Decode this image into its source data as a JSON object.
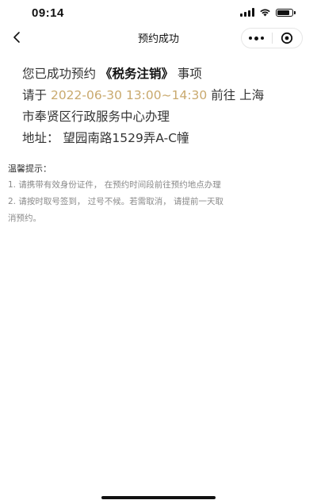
{
  "status_bar": {
    "time": "09:14"
  },
  "nav": {
    "back_icon": "chevron-left-icon",
    "title": "预约成功",
    "more_icon": "more-dots-icon",
    "close_icon": "target-circle-icon"
  },
  "message": {
    "line1_prefix": "您已成功预约",
    "line1_item": "《税务注销》",
    "line1_suffix": "事项",
    "line2_prefix": "请于",
    "line2_time": "2022-06-30 13:00~14:30",
    "line2_suffix": "前往 上海",
    "line3": "市奉贤区行政服务中心办理",
    "line4": "地址： 望园南路1529弄A-C幢",
    "accent_color": "#c9a96e"
  },
  "tips": {
    "title": "温馨提示：",
    "items": [
      "1. 请携带有效身份证件， 在预约时间段前往预约地点办理",
      "2. 请按时取号签到， 过号不候。若需取消， 请提前一天取",
      "消预约。"
    ]
  }
}
